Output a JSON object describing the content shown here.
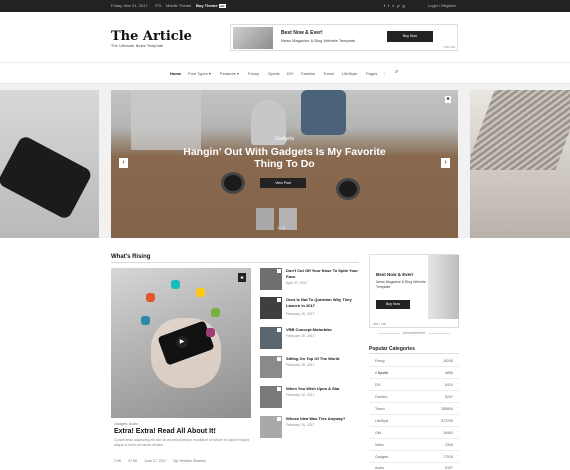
{
  "topbar": {
    "date": "Friday, Mar 31, 2017",
    "links": [
      "RTL",
      "Mobile Theme"
    ],
    "buy": "Buy Theme",
    "buy_badge": "Hot",
    "social_icons": [
      "facebook-icon",
      "twitter-icon",
      "vimeo-icon",
      "pinterest-icon",
      "google-plus-icon"
    ],
    "login": "Login / Register"
  },
  "header": {
    "logo": "The Article",
    "tagline": "The Ultimate News Template"
  },
  "ad_top": {
    "title": "Best Now & Ever!",
    "subtitle": "News Magazine & Blog Website Template.",
    "button": "Buy Now",
    "size": "728 x 90"
  },
  "nav": {
    "items": [
      "Home",
      "Post Types ▾",
      "Features ▾",
      "Funny",
      "Sports",
      "DIY",
      "Fashion",
      "Travel",
      "LifeStyle",
      "Pages"
    ]
  },
  "slider": {
    "category": "Gadgets",
    "title": "Hangin' Out With Gadgets Is My Favorite Thing To Do",
    "button": "View Post",
    "counter": "1 / 6",
    "prev": "‹",
    "next": "›",
    "corner": "✱"
  },
  "section": {
    "title": "What's Rising"
  },
  "featured": {
    "category": "Gadgets, Audio",
    "title": "Extra! Extra! Read All About It!",
    "excerpt": "Consectetur adipiscing elit sed do eiusmod tempor incididunt ut labore et dolore magna aliqua ut enim ad minim veniam",
    "meta": [
      "2.9K",
      "37.5K",
      "June 27, 2017",
      "By: Heather Sharkey"
    ]
  },
  "rising_list": [
    {
      "title": "Don't Cut Off Your Nose To Spite Your Face.",
      "date": "April 27, 2017"
    },
    {
      "title": "Ours Is Not To Question Why They Launch In 2017",
      "date": "February 15, 2017"
    },
    {
      "title": "VRB Concept Motorbike",
      "date": "February 15, 2017"
    },
    {
      "title": "Sitting On Top Of The World",
      "date": "February 15, 2017"
    },
    {
      "title": "When You Wish Upon A Star",
      "date": "February 15, 2017"
    },
    {
      "title": "Whose Idea Was This Anyway?",
      "date": "February 15, 2017"
    }
  ],
  "ad_side": {
    "title": "Best Now & Ever!",
    "subtitle": "News Magazine & Blog Website Template.",
    "button": "Buy Now",
    "size": "300 x 250",
    "label": "Advertisement"
  },
  "categories": {
    "title": "Popular Categories",
    "items": [
      {
        "name": "Funny",
        "count": "28245"
      },
      {
        "name": "» Sports",
        "count": "6856"
      },
      {
        "name": "DIY",
        "count": "8424"
      },
      {
        "name": "Fashion",
        "count": "6247"
      },
      {
        "name": "Travel",
        "count": "288659"
      },
      {
        "name": "LifeStyle",
        "count": "872239"
      },
      {
        "name": "Gifs",
        "count": "18463"
      },
      {
        "name": "Video",
        "count": "2346"
      },
      {
        "name": "Gadgets",
        "count": "77515"
      },
      {
        "name": "Audio",
        "count": "6197"
      }
    ]
  },
  "colors": {
    "dark": "#222222",
    "accent_bg": "#f1f1f1"
  }
}
